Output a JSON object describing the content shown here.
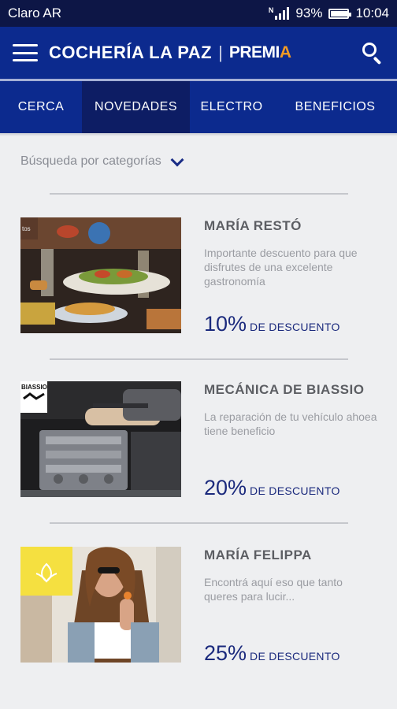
{
  "status_bar": {
    "carrier": "Claro AR",
    "network_label": "N",
    "battery": "93%",
    "time": "10:04"
  },
  "app_bar": {
    "title": "COCHERÍA LA PAZ",
    "separator": "|",
    "brand_main": "PREMI",
    "brand_accent": "A"
  },
  "tabs": [
    {
      "label": "CERCA",
      "active": false
    },
    {
      "label": "NOVEDADES",
      "active": true
    },
    {
      "label": "ELECTRO",
      "active": false
    },
    {
      "label": "BENEFICIOS",
      "active": false
    }
  ],
  "filter": {
    "label": "Búsqueda por categorías"
  },
  "offers": [
    {
      "title": "MARÍA RESTÓ",
      "description": "Importante descuento para que disfrutes de una excelente gastronomía",
      "percent": "10%",
      "discount_label": "DE DESCUENTO",
      "thumb_overlay": "tos"
    },
    {
      "title": "MECÁNICA DE BIASSIO",
      "description": "La reparación de tu vehículo ahoea tiene beneficio",
      "percent": "20%",
      "discount_label": "DE DESCUENTO",
      "thumb_overlay": "BIASSIO"
    },
    {
      "title": "MARÍA FELIPPA",
      "description": "Encontrá aquí eso que tanto queres para lucir...",
      "percent": "25%",
      "discount_label": "DE DESCUENTO",
      "thumb_overlay": ""
    }
  ],
  "colors": {
    "status_bar": "#0d1646",
    "header": "#0c2a8e",
    "active_tab": "#0d1d64",
    "accent": "#f29a24",
    "discount": "#1b2a7d"
  }
}
